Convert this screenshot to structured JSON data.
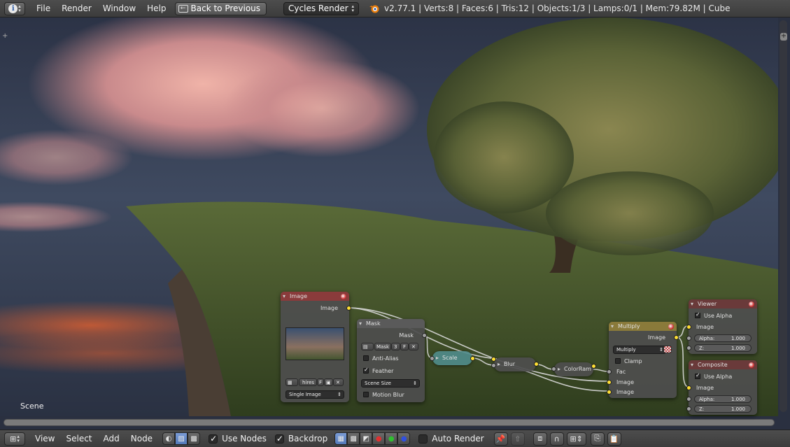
{
  "topbar": {
    "menu": [
      "File",
      "Render",
      "Window",
      "Help"
    ],
    "back_label": "Back to Previous",
    "render_engine": "Cycles Render",
    "stats": "v2.77.1 | Verts:8 | Faces:6 | Tris:12 | Objects:1/3 | Lamps:0/1 | Mem:79.82M | Cube"
  },
  "editor": {
    "scene_label": "Scene",
    "nodes": {
      "image": {
        "title": "Image",
        "output": "Image",
        "image_name": "hires",
        "fake_user": "F",
        "source": "Single Image"
      },
      "mask": {
        "title": "Mask",
        "output": "Mask",
        "mask_name": "Mask",
        "users": "3",
        "fake_user": "F",
        "anti_alias": "Anti-Alias",
        "feather": "Feather",
        "size_mode": "Scene Size",
        "motion_blur": "Motion Blur"
      },
      "scale": {
        "title": "Scale"
      },
      "blur": {
        "title": "Blur"
      },
      "colorramp": {
        "title": "ColorRam"
      },
      "multiply": {
        "title": "Multiply",
        "output": "Image",
        "blend_mode": "Multiply",
        "clamp": "Clamp",
        "input_fac": "Fac",
        "input_image1": "Image",
        "input_image2": "Image"
      },
      "viewer": {
        "title": "Viewer",
        "use_alpha": "Use Alpha",
        "input_image": "Image",
        "alpha_label": "Alpha:",
        "alpha_value": "1.000",
        "z_label": "Z:",
        "z_value": "1.000"
      },
      "composite": {
        "title": "Composite",
        "use_alpha": "Use Alpha",
        "input_image": "Image",
        "alpha_label": "Alpha:",
        "alpha_value": "1.000",
        "z_label": "Z:",
        "z_value": "1.000"
      }
    }
  },
  "bottombar": {
    "menu": [
      "View",
      "Select",
      "Add",
      "Node"
    ],
    "use_nodes": "Use Nodes",
    "backdrop": "Backdrop",
    "auto_render": "Auto Render"
  }
}
